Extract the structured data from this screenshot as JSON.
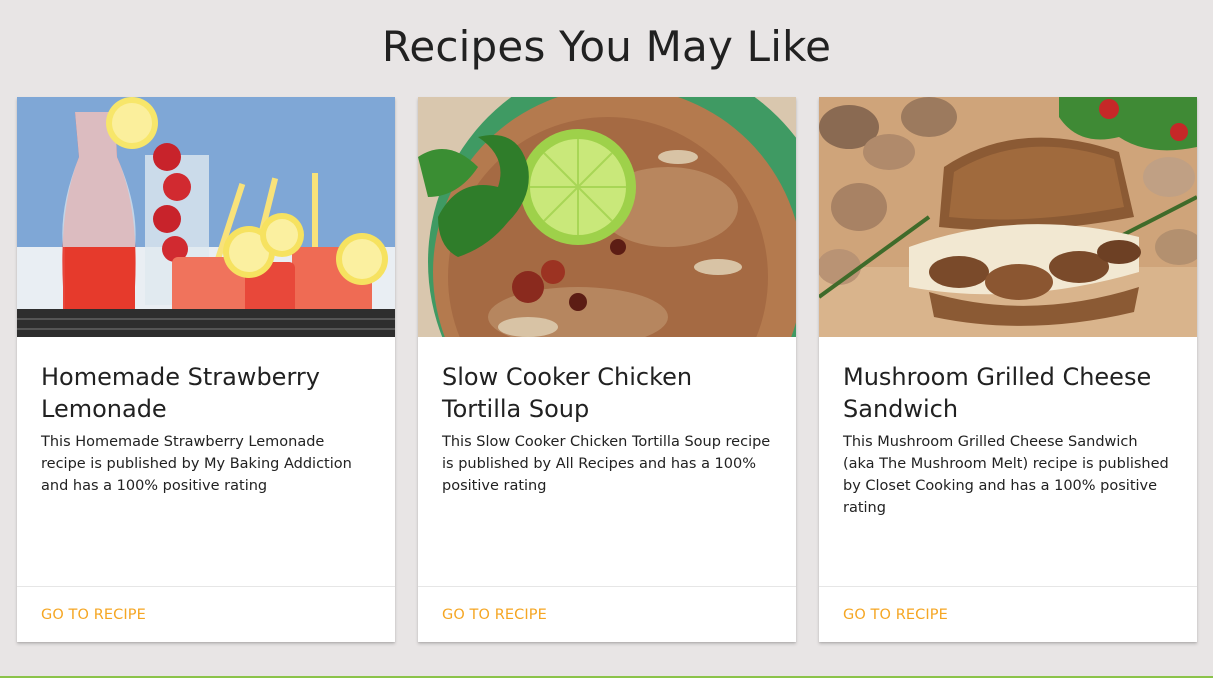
{
  "page": {
    "title": "Recipes You May Like"
  },
  "cards": [
    {
      "title": "Homemade Strawberry Lemonade",
      "description": "This Homemade Strawberry Lemonade recipe is published by My Baking Addiction and has a 100% positive rating",
      "action_label": "GO TO RECIPE",
      "image_alt": "strawberry lemonade photo"
    },
    {
      "title": "Slow Cooker Chicken Tortilla Soup",
      "description": "This Slow Cooker Chicken Tortilla Soup recipe is published by All Recipes and has a 100% positive rating",
      "action_label": "GO TO RECIPE",
      "image_alt": "tortilla soup photo"
    },
    {
      "title": "Mushroom Grilled Cheese Sandwich",
      "description": "This Mushroom Grilled Cheese Sandwich (aka The Mushroom Melt) recipe is published by Closet Cooking and has a 100% positive rating",
      "action_label": "GO TO RECIPE",
      "image_alt": "mushroom grilled cheese photo"
    }
  ],
  "colors": {
    "background": "#e8e5e5",
    "card": "#ffffff",
    "accent": "#f5a623",
    "title_text": "#212121"
  }
}
